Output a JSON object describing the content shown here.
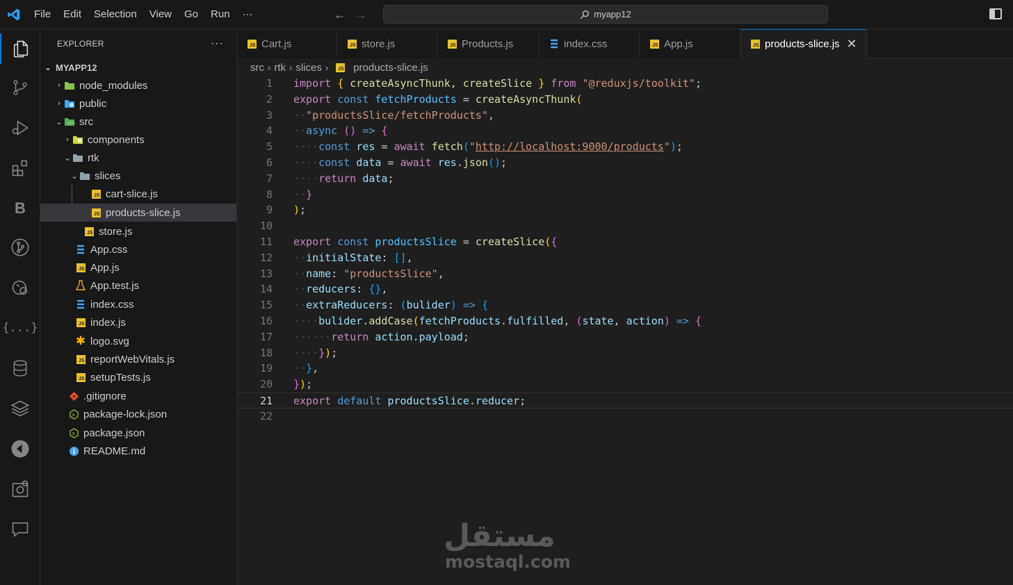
{
  "menu": {
    "file": "File",
    "edit": "Edit",
    "selection": "Selection",
    "view": "View",
    "go": "Go",
    "run": "Run",
    "more": "···"
  },
  "search": {
    "text": "myapp12"
  },
  "explorer": {
    "title": "EXPLORER",
    "more": "···",
    "root": "MYAPP12",
    "tree": [
      {
        "label": "node_modules",
        "type": "folder",
        "icon": "folder-node-icon"
      },
      {
        "label": "public",
        "type": "folder",
        "icon": "folder-public-icon"
      },
      {
        "label": "src",
        "type": "folder",
        "icon": "folder-src-icon"
      },
      {
        "label": "components",
        "type": "folder",
        "icon": "folder-components-icon"
      },
      {
        "label": "rtk",
        "type": "folder",
        "icon": "folder-icon"
      },
      {
        "label": "slices",
        "type": "folder",
        "icon": "folder-icon"
      },
      {
        "label": "cart-slice.js",
        "type": "file",
        "icon": "js-file-icon"
      },
      {
        "label": "products-slice.js",
        "type": "file",
        "icon": "js-file-icon"
      },
      {
        "label": "store.js",
        "type": "file",
        "icon": "js-file-icon"
      },
      {
        "label": "App.css",
        "type": "file",
        "icon": "css-file-icon"
      },
      {
        "label": "App.js",
        "type": "file",
        "icon": "js-file-icon"
      },
      {
        "label": "App.test.js",
        "type": "file",
        "icon": "test-flask-icon"
      },
      {
        "label": "index.css",
        "type": "file",
        "icon": "css-file-icon"
      },
      {
        "label": "index.js",
        "type": "file",
        "icon": "js-file-icon"
      },
      {
        "label": "logo.svg",
        "type": "file",
        "icon": "svg-file-icon"
      },
      {
        "label": "reportWebVitals.js",
        "type": "file",
        "icon": "js-file-icon"
      },
      {
        "label": "setupTests.js",
        "type": "file",
        "icon": "js-file-icon"
      },
      {
        "label": ".gitignore",
        "type": "file",
        "icon": "git-icon"
      },
      {
        "label": "package-lock.json",
        "type": "file",
        "icon": "node-json-icon"
      },
      {
        "label": "package.json",
        "type": "file",
        "icon": "node-json-icon"
      },
      {
        "label": "README.md",
        "type": "file",
        "icon": "info-icon"
      }
    ]
  },
  "tabs": [
    {
      "label": "Cart.js",
      "icon": "js-file-icon"
    },
    {
      "label": "store.js",
      "icon": "js-file-icon"
    },
    {
      "label": "Products.js",
      "icon": "js-file-icon"
    },
    {
      "label": "index.css",
      "icon": "css-file-icon"
    },
    {
      "label": "App.js",
      "icon": "js-file-icon"
    },
    {
      "label": "products-slice.js",
      "icon": "js-file-icon",
      "active": true,
      "close": "✕"
    }
  ],
  "breadcrumb": [
    "src",
    "rtk",
    "slices",
    "products-slice.js"
  ],
  "editor": {
    "current_line": 21,
    "line_numbers": [
      "1",
      "2",
      "3",
      "4",
      "5",
      "6",
      "7",
      "8",
      "9",
      "10",
      "11",
      "12",
      "13",
      "14",
      "15",
      "16",
      "17",
      "18",
      "19",
      "20",
      "21",
      "22"
    ],
    "lines": [
      "import { createAsyncThunk, createSlice } from \"@reduxjs/toolkit\";",
      "export const fetchProducts = createAsyncThunk(",
      "  \"productsSlice/fetchProducts\",",
      "  async () => {",
      "    const res = await fetch(\"http://localhost:9000/products\");",
      "    const data = await res.json();",
      "    return data;",
      "  }",
      ");",
      "",
      "export const productsSlice = createSlice({",
      "  initialState: [],",
      "  name: \"productsSlice\",",
      "  reducers: {},",
      "  extraReducers: (bulider) => {",
      "    bulider.addCase(fetchProducts.fulfilled, (state, action) => {",
      "      return action.payload;",
      "    });",
      "  },",
      "});",
      "export default productsSlice.reducer;",
      ""
    ]
  },
  "watermark": {
    "arabic": "مستقل",
    "latin": "mostaql.com"
  },
  "colors": {
    "accent": "#0078d4",
    "js_badge": "#e8c12c",
    "editor_bg": "#1f1f1f",
    "chrome_bg": "#181818"
  }
}
